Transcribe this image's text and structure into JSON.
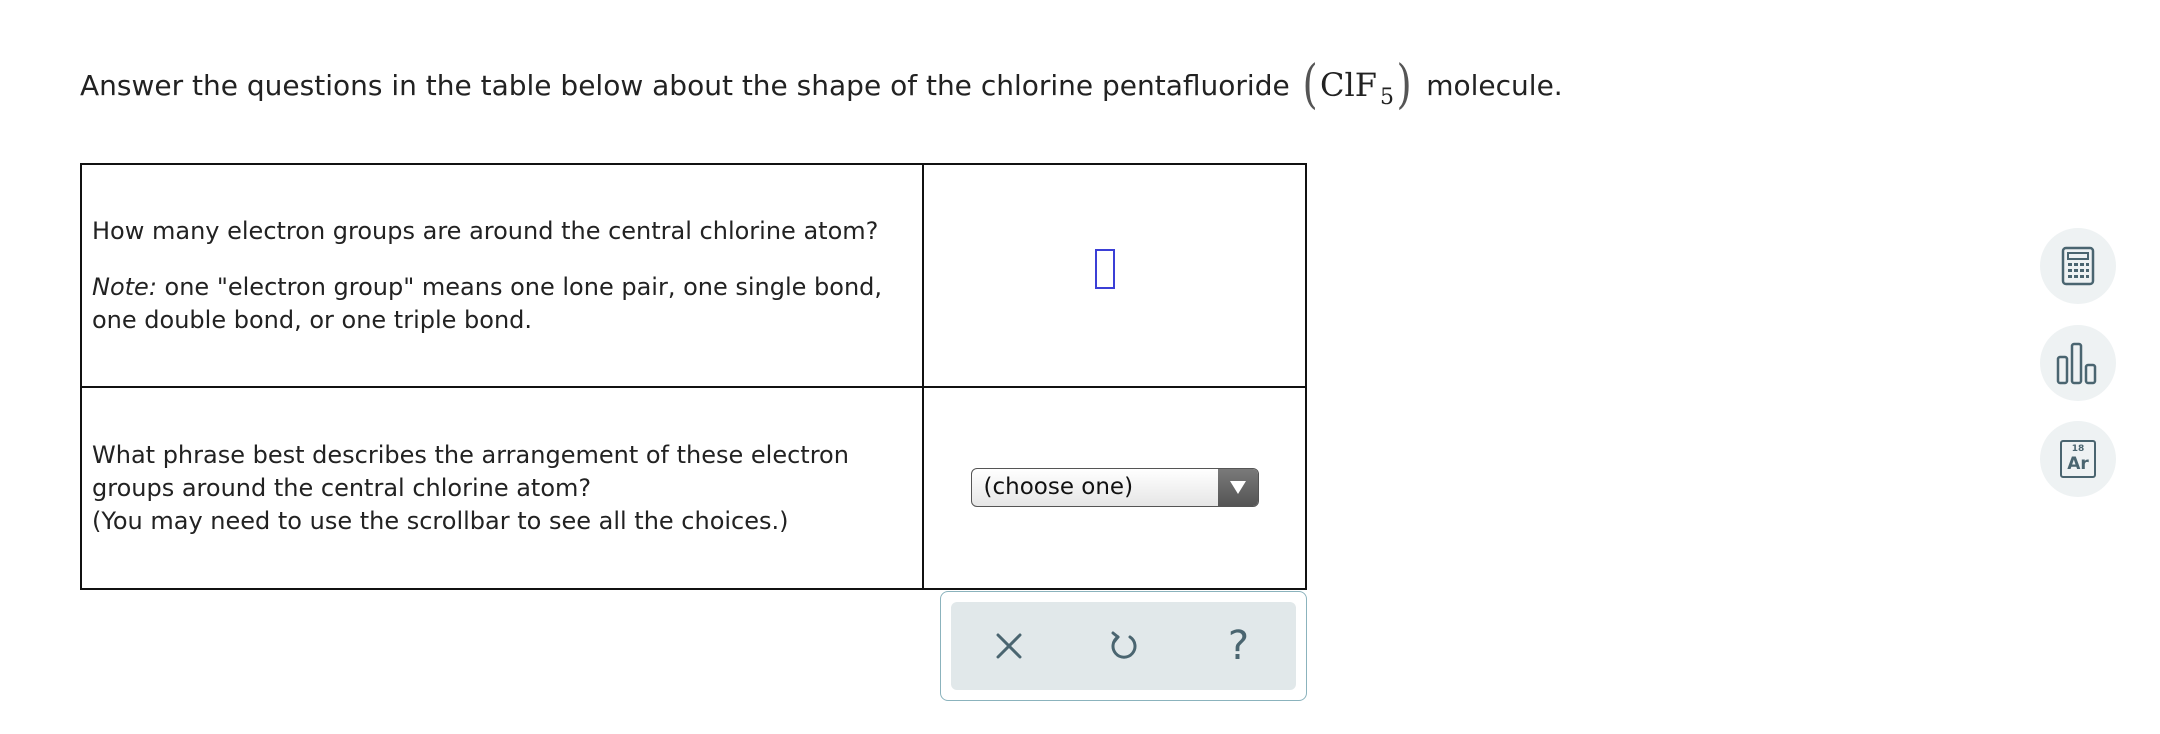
{
  "question": {
    "prefix": "Answer the questions in the table below about the shape of the chlorine pentafluoride",
    "formula_main": "ClF",
    "formula_sub": "5",
    "suffix": "molecule."
  },
  "rows": [
    {
      "question_line1": "How many electron groups are around the central chlorine atom?",
      "note_label": "Note:",
      "note_text": " one \"electron group\" means one lone pair, one single bond, one double bond, or one triple bond.",
      "answer_value": ""
    },
    {
      "question_text": "What phrase best describes the arrangement of these electron groups around the central chlorine atom?",
      "hint_text": "(You may need to use the scrollbar to see all the choices.)",
      "dropdown_selected": "(choose one)"
    }
  ],
  "actions": {
    "clear_icon": "x-icon",
    "undo_icon": "undo-icon",
    "help_label": "?"
  },
  "tools": {
    "calculator_icon": "calculator-icon",
    "chart_icon": "bar-chart-icon",
    "periodic_number": "18",
    "periodic_symbol": "Ar"
  },
  "colors": {
    "input_border": "#3b3fd6",
    "action_icon": "#4a6570",
    "panel_border": "#8bb3bd"
  }
}
